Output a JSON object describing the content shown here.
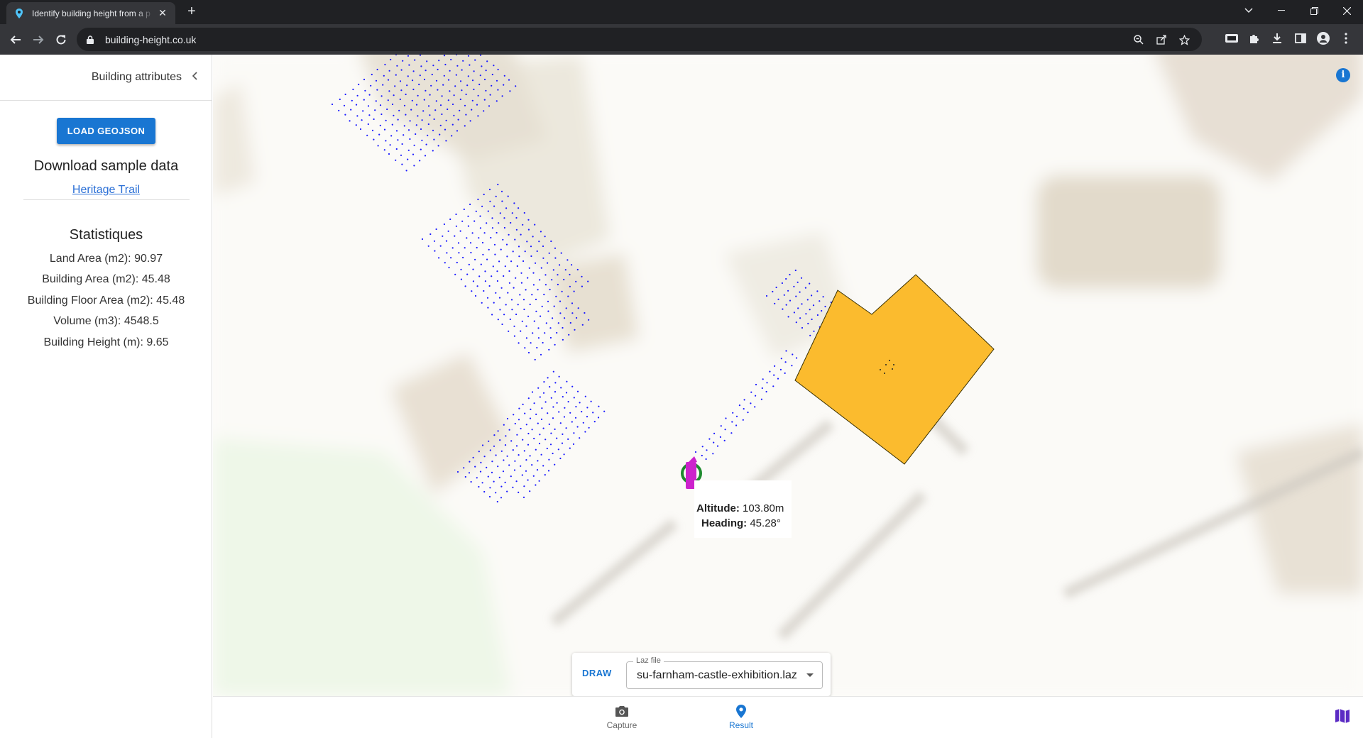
{
  "browser": {
    "tab_title": "Identify building height from a p",
    "url": "building-height.co.uk"
  },
  "sidebar": {
    "header_label": "Building attributes",
    "load_button": "LOAD GEOJSON",
    "download_title": "Download sample data",
    "sample_link": "Heritage Trail",
    "stats_title": "Statistiques",
    "stats": [
      "Land Area (m2): 90.97",
      "Building Area (m2): 45.48",
      "Building Floor Area (m2): 45.48",
      "Volume (m3): 4548.5",
      "Building Height (m): 9.65"
    ]
  },
  "map": {
    "popup": {
      "altitude_label": "Altitude:",
      "altitude_value": " 103.80m",
      "heading_label": "Heading:",
      "heading_value": " 45.28°"
    },
    "building_color": "#fbbb2e",
    "point_color": "#1a1aff",
    "camera_color": "#cc22cc"
  },
  "draw_panel": {
    "draw_button": "DRAW",
    "select_label": "Laz file",
    "select_value": "su-farnham-castle-exhibition.laz"
  },
  "bottom_nav": {
    "capture_label": "Capture",
    "result_label": "Result"
  },
  "colors": {
    "primary": "#1976d2"
  }
}
